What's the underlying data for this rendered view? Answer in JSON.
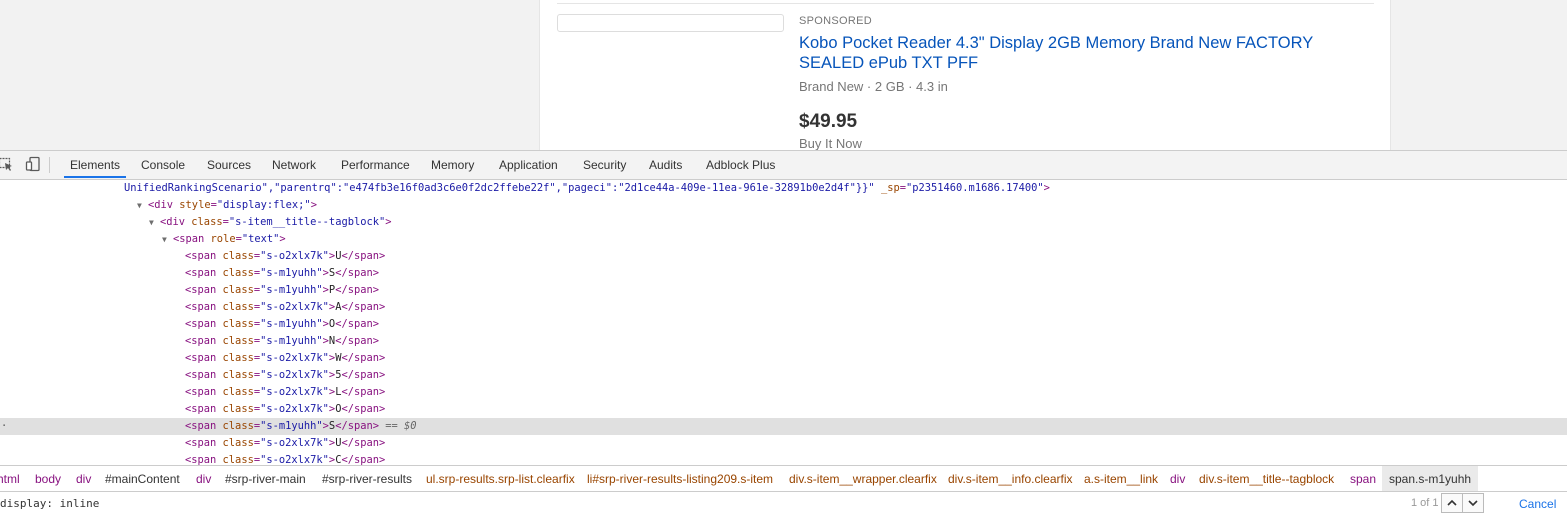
{
  "listing": {
    "sponsored": "SPONSORED",
    "title": "Kobo Pocket Reader 4.3\" Display 2GB Memory Brand New FACTORY SEALED ePub TXT PFF",
    "subtitle": "Brand New · 2 GB · 4.3 in",
    "price": "$49.95",
    "format": "Buy It Now"
  },
  "devtools": {
    "toolbar": {
      "inspect_icon": "select-element-icon",
      "device_icon": "device-toggle-icon"
    },
    "tabs": [
      "Elements",
      "Console",
      "Sources",
      "Network",
      "Performance",
      "Memory",
      "Application",
      "Security",
      "Audits",
      "Adblock Plus"
    ],
    "active_tab": "Elements",
    "dom": {
      "top_line": {
        "text": "UnifiedRankingScenario\",\"parentrq\":\"e474fb3e16f0ad3c6e0f2dc2ffebe22f\",\"pageci\":\"2d1ce44a-409e-11ea-961e-32891b0e2d4f\"}}\"",
        "attr": "_sp",
        "value": "\"p2351460.m1686.17400\"",
        "close": ">"
      },
      "flex_div": {
        "tag": "<div",
        "attr": "style",
        "value": "\"display:flex;\"",
        "close": ">"
      },
      "tagblock_div": {
        "tag": "<div",
        "attr": "class",
        "value": "\"s-item__title--tagblock\"",
        "close": ">"
      },
      "text_span": {
        "tag": "<span",
        "attr": "role",
        "value": "\"text\"",
        "close": ">"
      },
      "spans": [
        {
          "cls": "\"s-o2xlx7k\"",
          "char": "U"
        },
        {
          "cls": "\"s-m1yuhh\"",
          "char": "S"
        },
        {
          "cls": "\"s-m1yuhh\"",
          "char": "P"
        },
        {
          "cls": "\"s-o2xlx7k\"",
          "char": "A"
        },
        {
          "cls": "\"s-m1yuhh\"",
          "char": "O"
        },
        {
          "cls": "\"s-m1yuhh\"",
          "char": "N"
        },
        {
          "cls": "\"s-o2xlx7k\"",
          "char": "W"
        },
        {
          "cls": "\"s-o2xlx7k\"",
          "char": "5"
        },
        {
          "cls": "\"s-o2xlx7k\"",
          "char": "L"
        },
        {
          "cls": "\"s-o2xlx7k\"",
          "char": "O"
        },
        {
          "cls": "\"s-m1yuhh\"",
          "char": "S"
        },
        {
          "cls": "\"s-o2xlx7k\"",
          "char": "U"
        },
        {
          "cls": "\"s-o2xlx7k\"",
          "char": "C"
        }
      ],
      "selected_index": 10,
      "selected_marker": "== $0",
      "span_open": "<span",
      "span_attr": "class",
      "span_close_tag": "</span>",
      "gt": ">"
    },
    "breadcrumbs": [
      {
        "label": "html",
        "kind": "tagname"
      },
      {
        "label": "body",
        "kind": "tagname"
      },
      {
        "label": "div",
        "kind": "tagname"
      },
      {
        "label": "#mainContent",
        "kind": "idname"
      },
      {
        "label": "div",
        "kind": "tagname"
      },
      {
        "label": "#srp-river-main",
        "kind": "idname"
      },
      {
        "label": "#srp-river-results",
        "kind": "idname"
      },
      {
        "label": "ul.srp-results.srp-list.clearfix",
        "kind": "clsname"
      },
      {
        "label": "li#srp-river-results-listing209.s-item",
        "kind": "clsname"
      },
      {
        "label": "div.s-item__wrapper.clearfix",
        "kind": "clsname"
      },
      {
        "label": "div.s-item__info.clearfix",
        "kind": "clsname"
      },
      {
        "label": "a.s-item__link",
        "kind": "clsname"
      },
      {
        "label": "div",
        "kind": "tagname"
      },
      {
        "label": "div.s-item__title--tagblock",
        "kind": "clsname"
      },
      {
        "label": "span",
        "kind": "tagname"
      },
      {
        "label": "span.s-m1yuhh",
        "kind": "current"
      }
    ],
    "search": {
      "value": "display: inline",
      "match_count": "1 of 1",
      "up_icon": "chevron-up-icon",
      "down_icon": "chevron-down-icon",
      "cancel_label": "Cancel"
    }
  }
}
